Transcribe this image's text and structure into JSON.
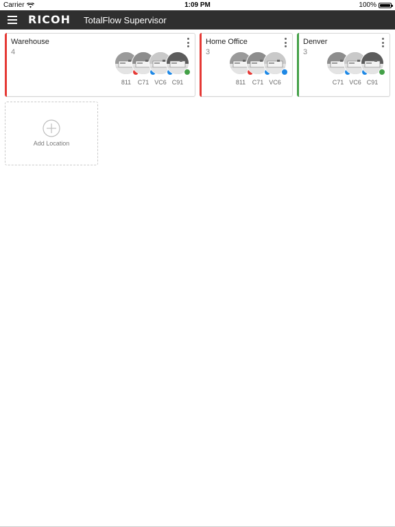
{
  "status_bar": {
    "carrier": "Carrier",
    "time": "1:09 PM",
    "battery": "100%"
  },
  "header": {
    "logo": "RICOH",
    "title": "TotalFlow Supervisor"
  },
  "colors": {
    "error": "#e53935",
    "ok": "#43a047",
    "active": "#1e88e5",
    "header_bg": "#2f2f2f"
  },
  "locations": [
    {
      "name": "Warehouse",
      "count": "4",
      "accent": "#e53935",
      "devices": [
        {
          "label": "811",
          "status_color": "#e53935",
          "tone": "#9a9a9a"
        },
        {
          "label": "C71",
          "status_color": "#1e88e5",
          "tone": "#8d8d8d"
        },
        {
          "label": "VC6",
          "status_color": "#1e88e5",
          "tone": "#c9c9c9"
        },
        {
          "label": "C91",
          "status_color": "#43a047",
          "tone": "#5c5c5c"
        }
      ]
    },
    {
      "name": "Home Office",
      "count": "3",
      "accent": "#e53935",
      "devices": [
        {
          "label": "811",
          "status_color": "#e53935",
          "tone": "#9a9a9a"
        },
        {
          "label": "C71",
          "status_color": "#1e88e5",
          "tone": "#8d8d8d"
        },
        {
          "label": "VC6",
          "status_color": "#1e88e5",
          "tone": "#c9c9c9"
        }
      ]
    },
    {
      "name": "Denver",
      "count": "3",
      "accent": "#43a047",
      "devices": [
        {
          "label": "C71",
          "status_color": "#1e88e5",
          "tone": "#8d8d8d"
        },
        {
          "label": "VC6",
          "status_color": "#1e88e5",
          "tone": "#c9c9c9"
        },
        {
          "label": "C91",
          "status_color": "#43a047",
          "tone": "#5c5c5c"
        }
      ]
    }
  ],
  "add_location": {
    "label": "Add Location"
  }
}
